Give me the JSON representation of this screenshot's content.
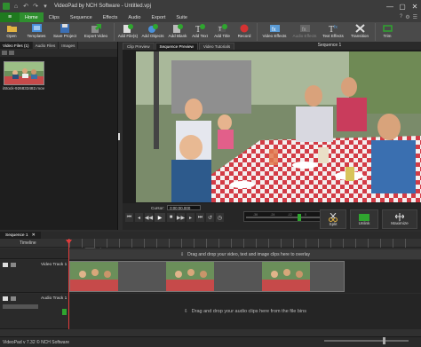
{
  "window": {
    "title": "VideoPad by NCH Software - Untitled.vpj",
    "controls": [
      "—",
      "▢",
      "✕"
    ]
  },
  "quick_access": [
    "⌂",
    "↶",
    "↷",
    "▾"
  ],
  "menu": {
    "tabs": [
      "Home",
      "Clips",
      "Sequence",
      "Effects",
      "Audio",
      "Export",
      "Suite"
    ],
    "active": "Home",
    "menu_icon": "≡",
    "right_icons": [
      "?",
      "⚙",
      "☰"
    ]
  },
  "toolbar": {
    "open": "Open",
    "templates": "Templates",
    "save_project": "Save Project",
    "export_video": "Export Video",
    "add_files": "Add File(s)",
    "add_objects": "Add Objects",
    "add_blank": "Add Blank",
    "add_text": "Add Text",
    "add_title": "Add Title",
    "record": "Record",
    "video_effects": "Video Effects",
    "audio_effects": "Audio Effects",
    "text_effects": "Text Effects",
    "transition": "Transition",
    "trim": "Trim"
  },
  "bin": {
    "tabs": [
      "Video Files",
      "Audio Files",
      "Images"
    ],
    "count_badge": "(1)",
    "clip_label": "iStock-926833482.mov"
  },
  "viewer": {
    "tabs": [
      "Clip Preview",
      "Sequence Preview",
      "Video Tutorials"
    ],
    "title": "Sequence 1",
    "cursor_label": "Cursor:",
    "cursor_time": "0:00:00.000",
    "split_label": "Split",
    "unlink_label": "Unlink",
    "maximize_label": "Maximize",
    "meter_ticks": [
      "-36",
      "-24",
      "-12",
      "0"
    ]
  },
  "timeline": {
    "sequence_tab": "Sequence 1",
    "ruler_label": "Timeline",
    "overlay_hint": "Drag and drop your video, text and image clips here to overlay",
    "video_track": "Video Track 1",
    "audio_track": "Audio Track 1",
    "audio_hint": "Drag and drop your audio clips here from the file bins"
  },
  "status": {
    "text": "VideoPad v 7.32 © NCH Software"
  },
  "colors": {
    "accent": "#2f8f2f",
    "playhead": "#e23b3b",
    "record": "#d43232"
  }
}
